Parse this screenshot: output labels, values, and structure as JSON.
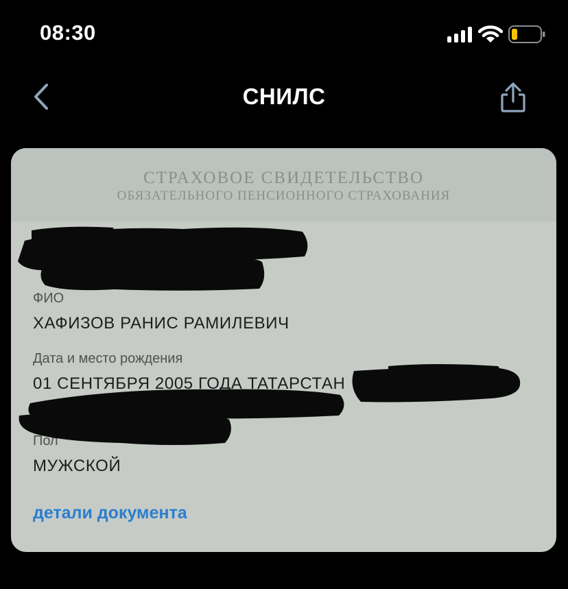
{
  "status_bar": {
    "time": "08:30",
    "icons": [
      "signal-icon",
      "wifi-icon",
      "battery-icon"
    ],
    "battery_color": "#f5c400"
  },
  "nav": {
    "title": "СНИЛС",
    "back_icon": "chevron-left-icon",
    "share_icon": "share-icon"
  },
  "card": {
    "header_line1": "СТРАХОВОЕ СВИДЕТЕЛЬСТВО",
    "header_line2": "ОБЯЗАТЕЛЬНОГО ПЕНСИОННОГО СТРАХОВАНИЯ",
    "fields": [
      {
        "label": "ФИО",
        "value": "ХАФИЗОВ РАНИС РАМИЛЕВИЧ"
      },
      {
        "label": "Дата и место рождения",
        "value": "01 СЕНТЯБРЯ 2005 ГОДА ТАТАРСТАН"
      },
      {
        "label": "Пол",
        "value": "МУЖСКОЙ"
      }
    ],
    "details_link": "детали документа",
    "link_color": "#2a7ed0"
  }
}
